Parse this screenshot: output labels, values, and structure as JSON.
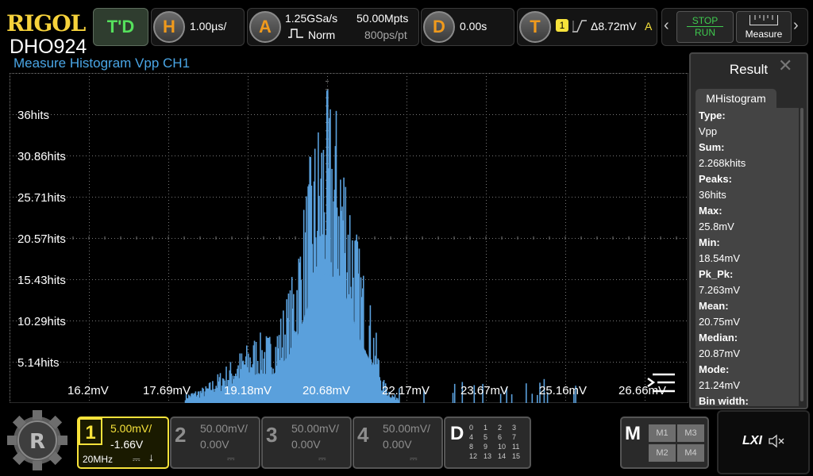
{
  "brand": {
    "logo": "RIGOL",
    "model": "DHO924"
  },
  "top": {
    "td_label": "T'D",
    "h": {
      "letter": "H",
      "timebase": "1.00µs/"
    },
    "a": {
      "letter": "A",
      "sample_rate": "1.25GSa/s",
      "mode": "Norm",
      "memory_depth": "50.00Mpts",
      "points_per_div": "800ps/pt"
    },
    "d": {
      "letter": "D",
      "delay": "0.00s"
    },
    "t": {
      "letter": "T",
      "source": "1",
      "level": "Δ8.72mV",
      "coupling": "A"
    },
    "stop": "STOP",
    "run": "RUN",
    "measure": "Measure"
  },
  "screen": {
    "title": "Measure Histogram  Vpp  CH1",
    "y_labels": [
      "36hits",
      "30.86hits",
      "25.71hits",
      "20.57hits",
      "15.43hits",
      "10.29hits",
      "5.14hits"
    ],
    "x_labels": [
      "16.2mV",
      "17.69mV",
      "19.18mV",
      "20.68mV",
      "22.17mV",
      "23.67mV",
      "25.16mV",
      "26.66mV"
    ]
  },
  "chart_data": {
    "type": "bar",
    "title": "Measure Histogram  Vpp  CH1",
    "xlabel": "",
    "ylabel": "",
    "xlim": [
      15.455,
      27.405
    ],
    "ylim": [
      0,
      41.14
    ],
    "x_ticks": [
      "16.2mV",
      "17.69mV",
      "19.18mV",
      "20.68mV",
      "22.17mV",
      "23.67mV",
      "25.16mV",
      "26.66mV"
    ],
    "y_ticks": [
      "5.14hits",
      "10.29hits",
      "15.43hits",
      "20.57hits",
      "25.71hits",
      "30.86hits",
      "36hits"
    ],
    "envelope_x": [
      18.54,
      18.9,
      19.2,
      19.5,
      19.8,
      20.1,
      20.4,
      20.6,
      20.75,
      20.87,
      21.0,
      21.24,
      21.4,
      21.6,
      21.9,
      22.0,
      22.2,
      25.8
    ],
    "envelope_y": [
      1,
      2,
      4,
      6,
      8,
      8,
      14,
      22,
      29,
      33,
      36,
      34,
      28,
      18,
      8,
      3,
      1,
      1
    ],
    "color": "#5aa0dc"
  },
  "result": {
    "title": "Result",
    "tab": "MHistogram",
    "items": [
      {
        "k": "Type:",
        "v": "Vpp"
      },
      {
        "k": "Sum:",
        "v": "2.268khits"
      },
      {
        "k": "Peaks:",
        "v": "36hits"
      },
      {
        "k": "Max:",
        "v": "25.8mV"
      },
      {
        "k": "Min:",
        "v": "18.54mV"
      },
      {
        "k": "Pk_Pk:",
        "v": "7.263mV"
      },
      {
        "k": "Mean:",
        "v": "20.75mV"
      },
      {
        "k": "Median:",
        "v": "20.87mV"
      },
      {
        "k": "Mode:",
        "v": "21.24mV"
      },
      {
        "k": "Bin width:",
        "v": ""
      }
    ]
  },
  "bottom": {
    "ch1": {
      "num": "1",
      "scale": "5.00mV/",
      "offset": "-1.66V",
      "bw": "20MHz"
    },
    "ch2": {
      "num": "2",
      "scale": "50.00mV/",
      "offset": "0.00V"
    },
    "ch3": {
      "num": "3",
      "scale": "50.00mV/",
      "offset": "0.00V"
    },
    "ch4": {
      "num": "4",
      "scale": "50.00mV/",
      "offset": "0.00V"
    },
    "d": {
      "letter": "D",
      "nums": [
        "0",
        "1",
        "2",
        "3",
        "4",
        "5",
        "6",
        "7",
        "8",
        "9",
        "10",
        "11",
        "12",
        "13",
        "14",
        "15"
      ]
    },
    "m": {
      "letter": "M",
      "items": [
        "M1",
        "M3",
        "M2",
        "M4"
      ]
    },
    "lxi": "LXI"
  }
}
